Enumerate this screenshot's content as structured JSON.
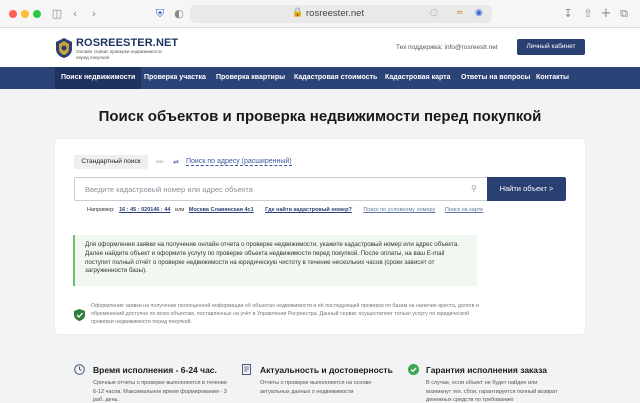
{
  "browser": {
    "url": "rosreester.net",
    "icons": [
      "sidebar-icon",
      "back-icon",
      "forward-icon",
      "shield-icon",
      "privacy-icon",
      "translate-icon",
      "rss-icon",
      "reader-icon",
      "download-icon",
      "share-icon",
      "new-tab-icon",
      "tabs-icon"
    ]
  },
  "header": {
    "logo_title": "ROSREESTER.NET",
    "logo_subtitle": "Онлайн сервис проверки недвижимости перед покупкой",
    "support": "Тех поддержка: info@rosreestr.net",
    "cabinet_button": "Личный кабинет"
  },
  "nav": {
    "items": [
      {
        "label": "Поиск недвижимости",
        "active": true
      },
      {
        "label": "Проверка участка"
      },
      {
        "label": "Проверка квартиры"
      },
      {
        "label": "Кадастровая стоимость"
      },
      {
        "label": "Кадастровая карта"
      },
      {
        "label": "Ответы на вопросы"
      },
      {
        "label": "Контакты"
      }
    ]
  },
  "hero": {
    "title": "Поиск объектов и проверка недвижимости перед покупкой"
  },
  "search": {
    "tab_standard": "Стандартный поиск",
    "or": "или",
    "tab_advanced": "Поиск по адресу (расширенный)",
    "placeholder": "Введите кадастровый номер или адрес объекта",
    "button": "Найти объект >",
    "example_prefix": "Например:",
    "example_code": "16 : 45 : 020146 : 44",
    "example_or": "или",
    "example_address": "Москва Славянская 4с1",
    "link_where": "Где найти кадастровый номер?",
    "link_conditional": "Поиск по условному номеру",
    "link_map": "Поиск на карте"
  },
  "info": {
    "text": "Для оформления заявки на получение онлайн отчета о проверке недвижимости, укажите кадастровый номер или адрес объекта. Далее найдите объект и оформите услугу по проверке объекта недвижимости перед покупкой. После оплаты, на ваш E-mail поступит полный отчёт о проверке недвижимости на юридическую чистоту в течение нескольких часов (сроки зависят от загруженности базы)."
  },
  "disclaimer": {
    "text": "Оформление заявки на получение полноценной информации об объектах недвижимости и её последующей проверки по базам на наличие ареста, долгов и обременений доступно по всем объектам, поставленных на учёт в Управлении Росреестра. Данный сервис осуществляет только услугу по юридической проверки недвижимости перед покупкой."
  },
  "features": [
    {
      "icon": "clock-icon",
      "title": "Время исполнения - 6-24 час.",
      "text": "Срочные отчеты о проверке выполняются в течение 6-12 часов. Максимальное время формирования - 3 раб. день."
    },
    {
      "icon": "document-icon",
      "title": "Актуальность и достоверность",
      "text": "Отчеты о проверке выполняются на основе актуальных данных о недвижимости"
    },
    {
      "icon": "checkmark-icon",
      "title": "Гарантия исполнения заказа",
      "text": "В случае, если объект не будет найден или возникнут тех. сбои, гарантируется полный возврат денежных средств по требованию"
    }
  ],
  "colors": {
    "brand_navy": "#2a3f72",
    "nav_bg": "#2c4378",
    "link_blue": "#3b57a4",
    "info_green": "#6fbf73",
    "feature_green": "#3aa655"
  }
}
